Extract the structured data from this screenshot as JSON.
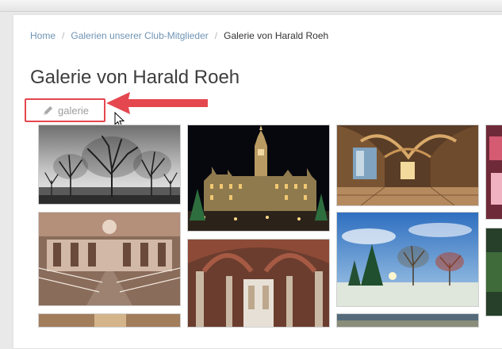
{
  "breadcrumb": {
    "items": [
      "Home",
      "Galerien unserer Club-Mitglieder",
      "Galerie von Harald Roeh"
    ],
    "separator": "/"
  },
  "page": {
    "title": "Galerie von Harald Roeh"
  },
  "tag": {
    "label": "galerie",
    "icon": "pencil-icon"
  },
  "colors": {
    "link": "#6f93b4",
    "annotation": "#e5474f",
    "title": "#3d3d3d"
  },
  "gallery": {
    "photos": [
      "bw-trees-photo",
      "marienplatz-town-hall-photo",
      "gothic-hall-photo",
      "baroque-staircase-photo",
      "gothic-vault-photo",
      "winter-park-photo",
      "partial-photo-right-top",
      "partial-photo-right-bottom",
      "partial-photo-bottom-left",
      "partial-photo-bottom-right"
    ]
  }
}
